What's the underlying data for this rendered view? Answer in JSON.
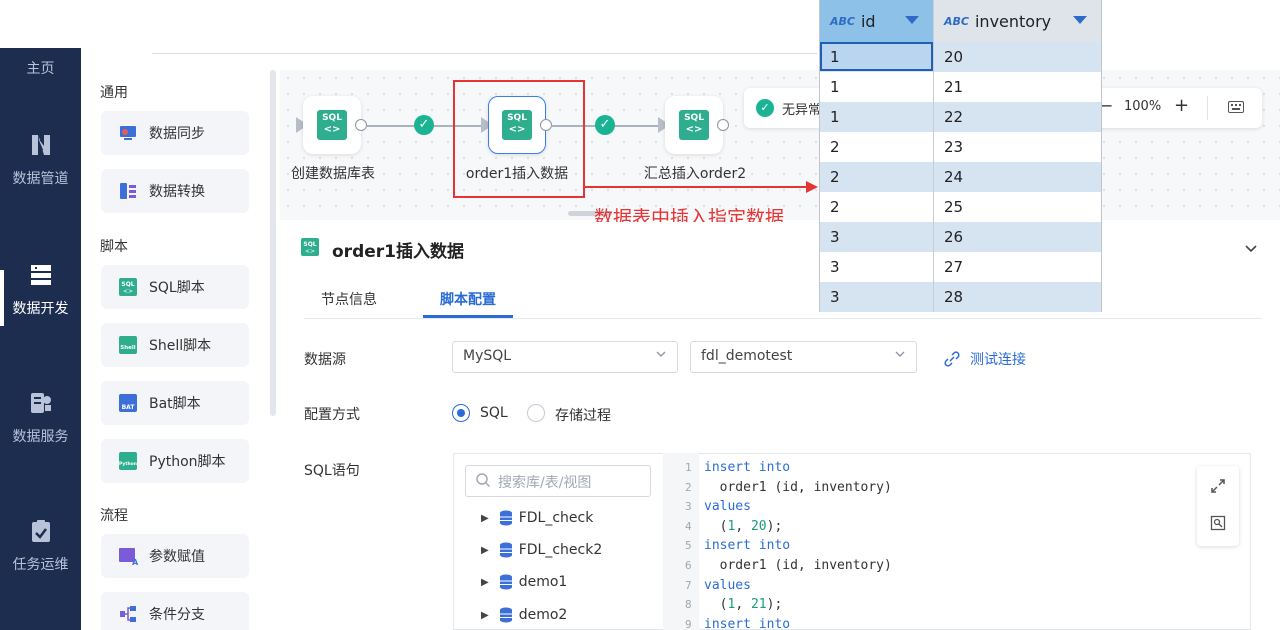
{
  "nav": {
    "home": "主页",
    "items": [
      {
        "label": "数据管道",
        "icon": "pipeline-icon"
      },
      {
        "label": "数据开发",
        "icon": "dev-icon",
        "active": true
      },
      {
        "label": "数据服务",
        "icon": "service-icon"
      },
      {
        "label": "任务运维",
        "icon": "ops-icon"
      }
    ]
  },
  "palette": {
    "sections": {
      "general": "通用",
      "script": "脚本",
      "flow": "流程"
    },
    "items": {
      "data_sync": "数据同步",
      "data_transform": "数据转换",
      "sql": "SQL脚本",
      "shell": "Shell脚本",
      "bat": "Bat脚本",
      "python": "Python脚本",
      "param": "参数赋值",
      "branch": "条件分支"
    }
  },
  "canvas": {
    "nodes": [
      {
        "label": "创建数据库表"
      },
      {
        "label": "order1插入数据"
      },
      {
        "label": "汇总插入order2"
      }
    ],
    "status": "无异常",
    "zoom": "100%",
    "annotation": "数据表中插入指定数据"
  },
  "detail": {
    "title": "order1插入数据",
    "tabs": [
      "节点信息",
      "脚本配置"
    ],
    "datasource_label": "数据源",
    "datasource_type": "MySQL",
    "datasource_db": "fdl_demotest",
    "test_connection": "测试连接",
    "config_label": "配置方式",
    "radio_sql": "SQL",
    "radio_proc": "存储过程",
    "sql_label": "SQL语句",
    "search_placeholder": "搜索库/表/视图",
    "tree": [
      "FDL_check",
      "FDL_check2",
      "demo1",
      "demo2"
    ]
  },
  "code_lines": [
    {
      "n": "1",
      "kw": "insert into",
      "rest": ""
    },
    {
      "n": "2",
      "kw": "",
      "rest": "  order1 (id, inventory)"
    },
    {
      "n": "3",
      "kw": "values",
      "rest": ""
    },
    {
      "n": "4",
      "kw": "",
      "rest": "  (1, 20);"
    },
    {
      "n": "5",
      "kw": "insert into",
      "rest": ""
    },
    {
      "n": "6",
      "kw": "",
      "rest": "  order1 (id, inventory)"
    },
    {
      "n": "7",
      "kw": "values",
      "rest": ""
    },
    {
      "n": "8",
      "kw": "",
      "rest": "  (1, 21);"
    },
    {
      "n": "9",
      "kw": "insert into",
      "rest": ""
    }
  ],
  "table": {
    "type_tag": "ABC",
    "columns": [
      "id",
      "inventory"
    ],
    "rows": [
      [
        "1",
        "20"
      ],
      [
        "1",
        "21"
      ],
      [
        "1",
        "22"
      ],
      [
        "2",
        "23"
      ],
      [
        "2",
        "24"
      ],
      [
        "2",
        "25"
      ],
      [
        "3",
        "26"
      ],
      [
        "3",
        "27"
      ],
      [
        "3",
        "28"
      ]
    ]
  },
  "colors": {
    "nav_bg": "#1d2d4f",
    "accent": "#2a6cd6",
    "success": "#1ab394",
    "annotation": "#e63333",
    "sql_icon": "#2fae8f"
  }
}
